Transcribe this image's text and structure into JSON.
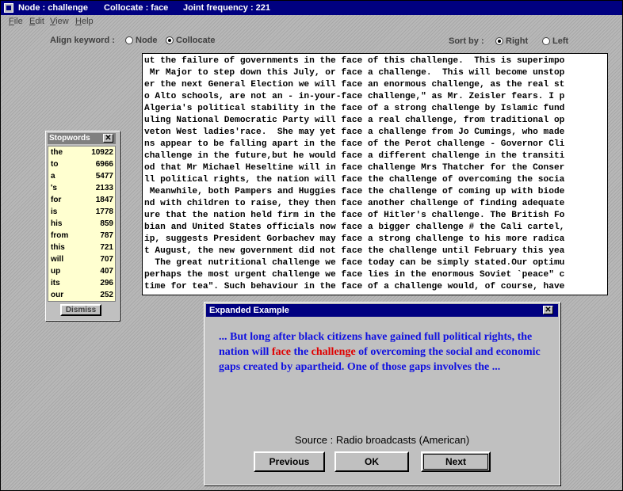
{
  "window": {
    "title_node": "Node : challenge",
    "title_collocate": "Collocate : face",
    "title_joint": "Joint frequency : 221"
  },
  "menu": [
    "File",
    "Edit",
    "View",
    "Help"
  ],
  "options": {
    "align_label": "Align keyword :",
    "align_node": "Node",
    "align_collocate": "Collocate",
    "align_selected": "Collocate",
    "sort_label": "Sort by :",
    "sort_right": "Right",
    "sort_left": "Left",
    "sort_selected": "Right"
  },
  "concordance": [
    "ut the failure of governments in the face of this challenge.  This is superimpo",
    " Mr Major to step down this July, or face a challenge.  This will become unstop",
    "er the next General Election we will face an enormous challenge, as the real st",
    "o Alto schools, are not an - in-your-face challenge,\" as Mr. Zeisler fears. I p",
    "Algeria's political stability in the face of a strong challenge by Islamic fund",
    "uling National Democratic Party will face a real challenge, from traditional op",
    "veton West ladies'race.  She may yet face a challenge from Jo Cumings, who made",
    "ns appear to be falling apart in the face of the Perot challenge - Governor Cli",
    "challenge in the future,but he would face a different challenge in the transiti",
    "od that Mr Michael Heseltine will in face challenge Mrs Thatcher for the Conser",
    "ll political rights, the nation will face the challenge of overcoming the socia",
    " Meanwhile, both Pampers and Huggies face the challenge of coming up with biode",
    "nd with children to raise, they then face another challenge of finding adequate",
    "ure that the nation held firm in the face of Hitler's challenge. The British Fo",
    "bian and United States officials now face a bigger challenge # the Cali cartel,",
    "ip, suggests President Gorbachev may face a strong challenge to his more radica",
    "t August, the new government did not face the challenge until February this yea",
    "  The great nutritional challenge we face today can be simply stated.Our optimu",
    "perhaps the most urgent challenge we face lies in the enormous Soviet `peace\" c",
    "time for tea\". Such behaviour in the face of a challenge would, of course, have"
  ],
  "stopwords": {
    "title": "Stopwords",
    "dismiss": "Dismiss",
    "items": [
      {
        "word": "the",
        "count": "10922"
      },
      {
        "word": "to",
        "count": "6966"
      },
      {
        "word": "a",
        "count": "5477"
      },
      {
        "word": "'s",
        "count": "2133"
      },
      {
        "word": "for",
        "count": "1847"
      },
      {
        "word": "is",
        "count": "1778"
      },
      {
        "word": "his",
        "count": "859"
      },
      {
        "word": "from",
        "count": "787"
      },
      {
        "word": "this",
        "count": "721"
      },
      {
        "word": "will",
        "count": "707"
      },
      {
        "word": "up",
        "count": "407"
      },
      {
        "word": "its",
        "count": "296"
      },
      {
        "word": "our",
        "count": "252"
      }
    ]
  },
  "dialog": {
    "title": "Expanded Example",
    "text_before": "... But long after black citizens have gained full political rights, the nation will ",
    "collocate": "face",
    "text_between": " the ",
    "node": "challenge",
    "text_after": " of overcoming the social and economic gaps created by apartheid. One of those gaps involves the ...",
    "source": "Source : Radio broadcasts (American)",
    "buttons": {
      "previous": "Previous",
      "ok": "OK",
      "next": "Next"
    }
  },
  "colors": {
    "title_active": "#000080",
    "highlight": "#e00000",
    "example_text": "#1010e0",
    "stoplist_bg": "#ffffd0"
  },
  "icons": [
    "system-menu-icon",
    "close-icon"
  ]
}
